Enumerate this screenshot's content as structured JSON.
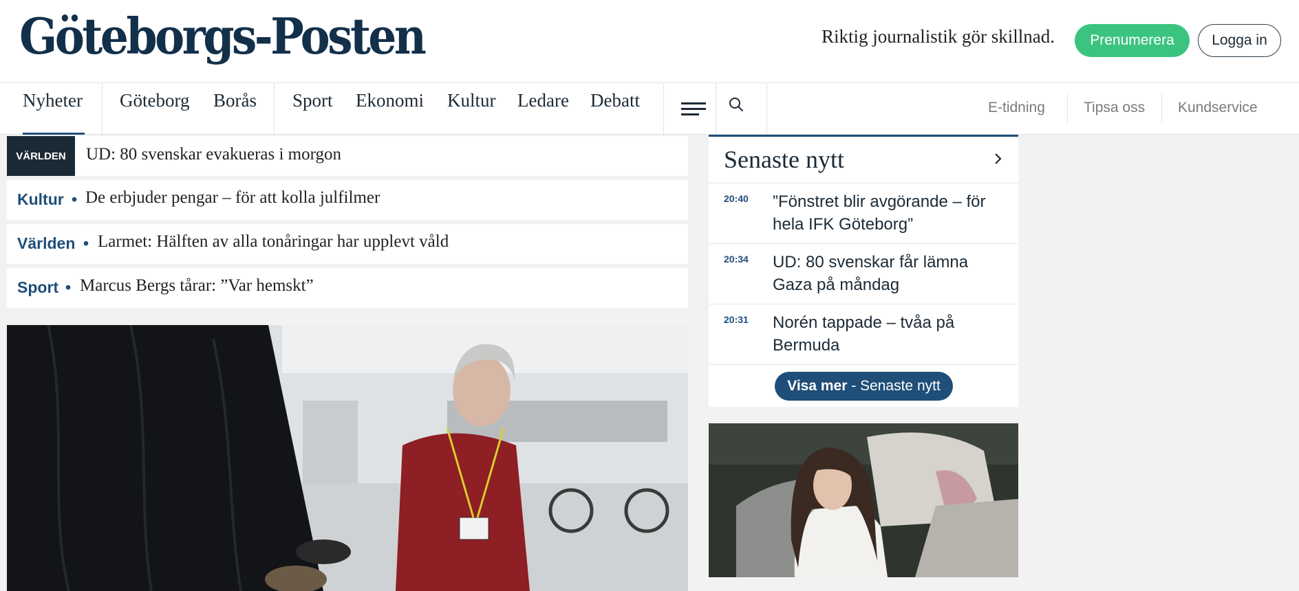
{
  "header": {
    "logo": "Göteborgs-Posten",
    "tagline": "Riktig journalistik gör skillnad.",
    "subscribe_label": "Prenumerera",
    "login_label": "Logga in"
  },
  "nav": {
    "items": [
      "Nyheter",
      "Göteborg",
      "Borås",
      "Sport",
      "Ekonomi",
      "Kultur",
      "Ledare",
      "Debatt"
    ],
    "active": "Nyheter",
    "right_links": [
      "E-tidning",
      "Tipsa oss",
      "Kundservice"
    ],
    "menu_icon": "hamburger-menu-icon",
    "search_icon": "search-icon"
  },
  "headlines": [
    {
      "tag": "VÄRLDEN",
      "text": "UD: 80 svenskar evakueras i morgon"
    },
    {
      "category": "Kultur",
      "text": "De erbjuder pengar – för att kolla julfilmer"
    },
    {
      "category": "Världen",
      "text": "Larmet: Hälften av alla tonåringar har upplevt våld"
    },
    {
      "category": "Sport",
      "text": "Marcus Bergs tårar: ”Var hemskt”"
    }
  ],
  "latest": {
    "title": "Senaste nytt",
    "items": [
      {
        "time": "20:40",
        "text": "”Fönstret blir avgörande – för hela IFK Göteborg”"
      },
      {
        "time": "20:34",
        "text": "UD: 80 svenskar får lämna Gaza på måndag"
      },
      {
        "time": "20:31",
        "text": "Norén tappade – tvåa på Bermuda"
      }
    ],
    "more_bold": "Visa mer",
    "more_rest": " - Senaste nytt"
  },
  "colors": {
    "brand_navy": "#13304b",
    "accent_blue": "#1f4e79",
    "subscribe_green": "#3bc47f",
    "page_bg": "#f2f2f2"
  }
}
